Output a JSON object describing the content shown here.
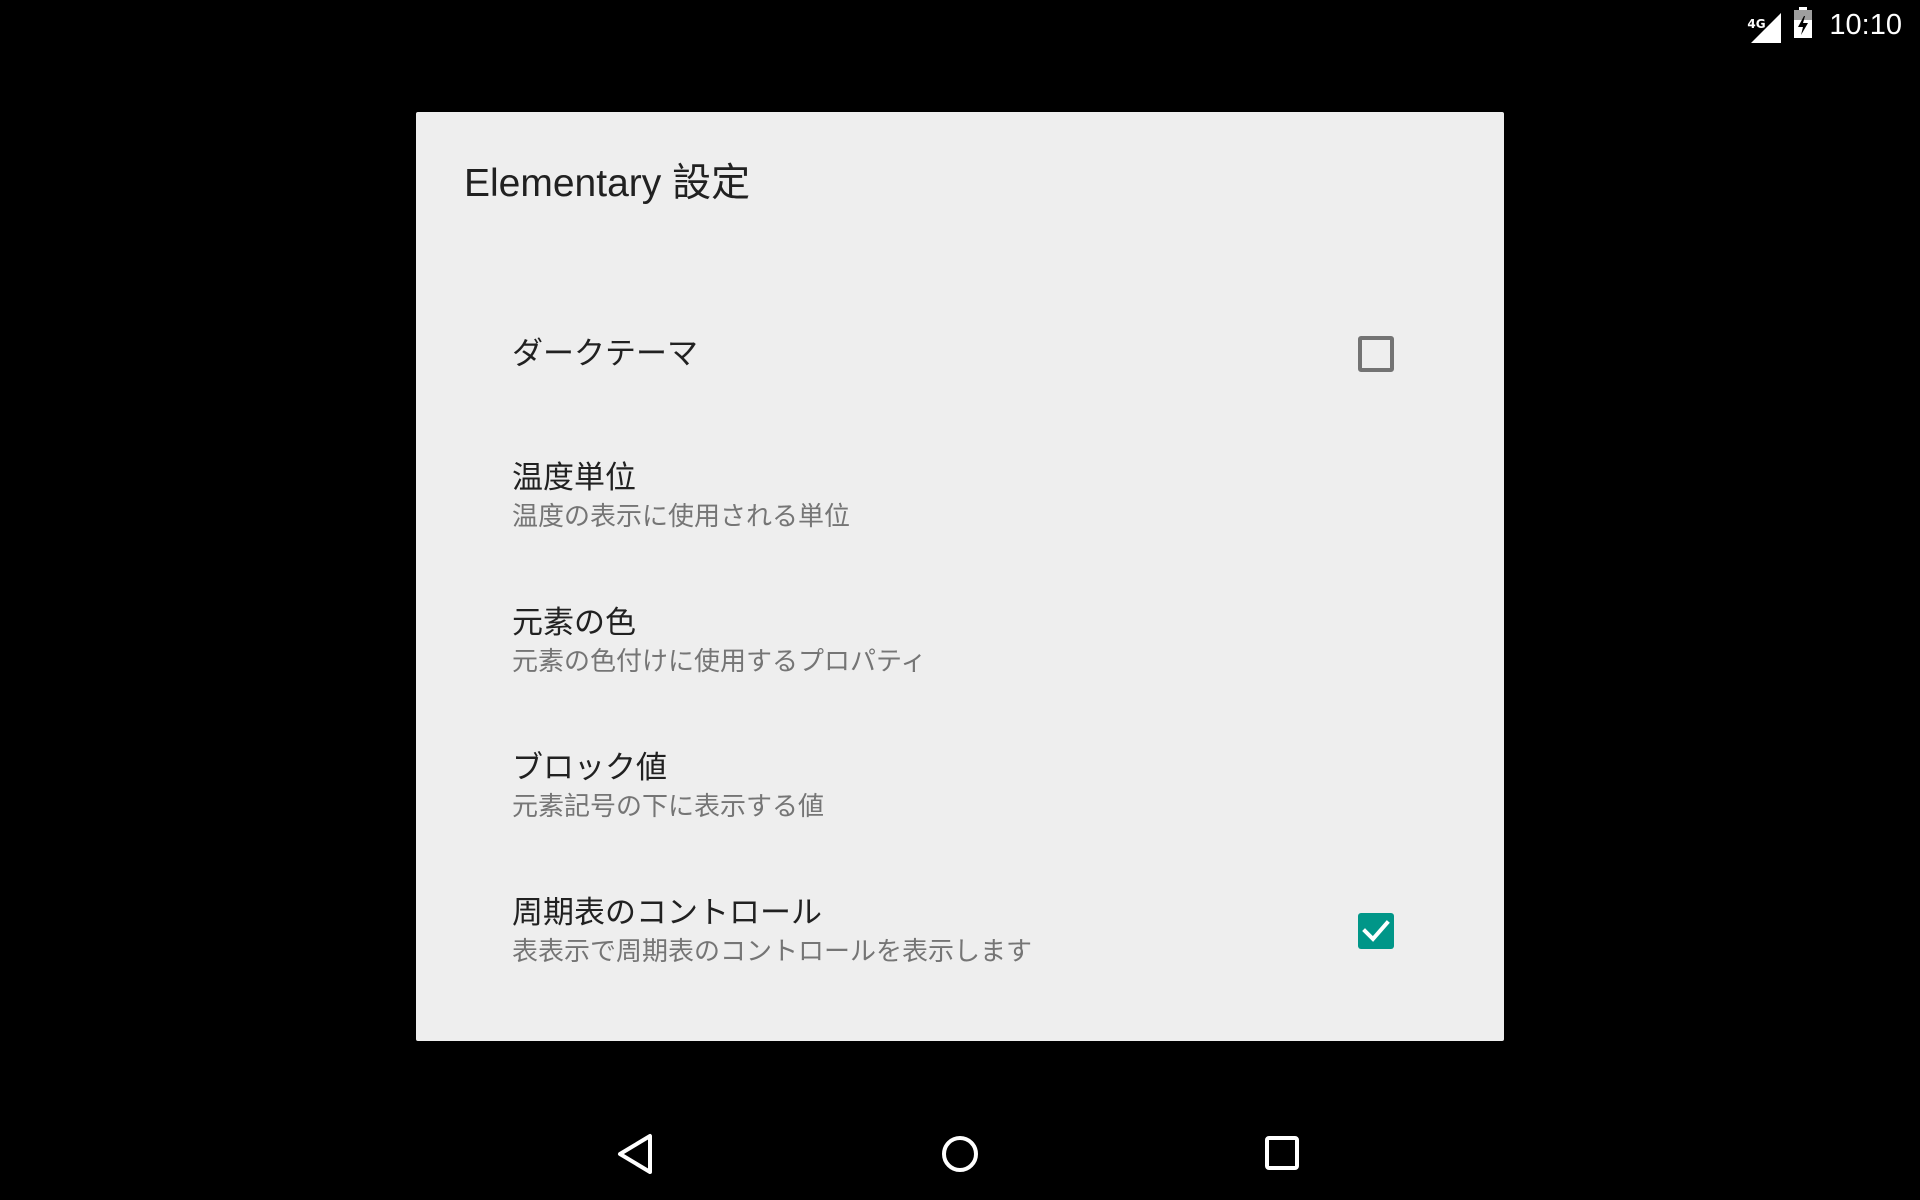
{
  "status_bar": {
    "network_label": "4G",
    "time": "10:10",
    "icons": [
      "signal-icon",
      "battery-charging-icon"
    ]
  },
  "dialog": {
    "title": "Elementary 設定",
    "preferences": [
      {
        "title": "ダークテーマ",
        "summary": "",
        "checkbox": true,
        "checked": false
      },
      {
        "title": "温度単位",
        "summary": "温度の表示に使用される単位",
        "checkbox": false
      },
      {
        "title": "元素の色",
        "summary": "元素の色付けに使用するプロパティ",
        "checkbox": false
      },
      {
        "title": "ブロック値",
        "summary": "元素記号の下に表示する値",
        "checkbox": false
      },
      {
        "title": "周期表のコントロール",
        "summary": "表表示で周期表のコントロールを表示します",
        "checkbox": true,
        "checked": true
      }
    ]
  },
  "nav_bar": {
    "buttons": [
      "back-icon",
      "home-icon",
      "recents-icon"
    ]
  },
  "colors": {
    "accent": "#009688",
    "dialog_background": "#eeeeee",
    "screen_background": "#000000"
  }
}
